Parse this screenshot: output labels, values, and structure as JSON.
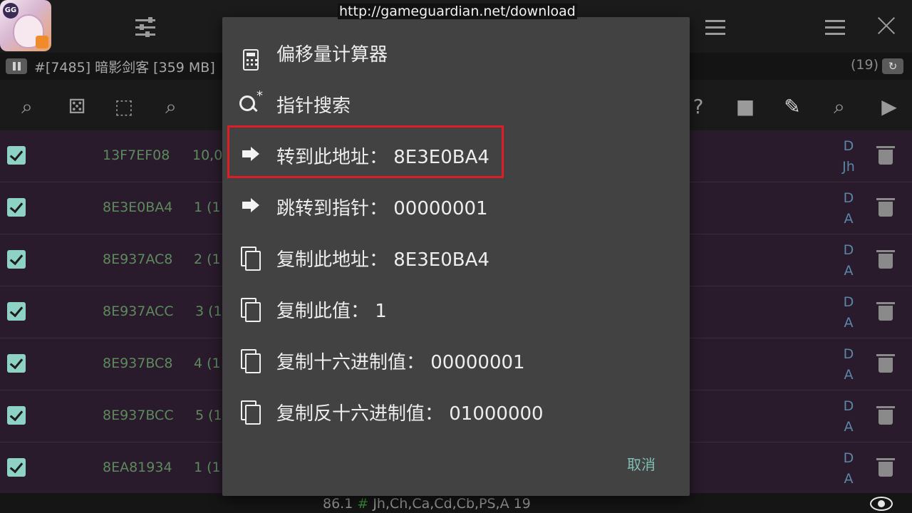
{
  "url_overlay": "http://gameguardian.net/download",
  "status": {
    "process": "#[7485] 暗影剑客 [359 MB]",
    "count": "(19)"
  },
  "rows": [
    {
      "address": "13F7EF08",
      "value": "10,0",
      "type_top": "D",
      "type_bottom": "Jh"
    },
    {
      "address": "8E3E0BA4",
      "value": "1 (1",
      "type_top": "D",
      "type_bottom": "A"
    },
    {
      "address": "8E937AC8",
      "value": "2 (1",
      "type_top": "D",
      "type_bottom": "A"
    },
    {
      "address": "8E937ACC",
      "value": "3 (1",
      "type_top": "D",
      "type_bottom": "A"
    },
    {
      "address": "8E937BC8",
      "value": "4 (1",
      "type_top": "D",
      "type_bottom": "A"
    },
    {
      "address": "8E937BCC",
      "value": "5 (1",
      "type_top": "D",
      "type_bottom": "A"
    },
    {
      "address": "8EA81934",
      "value": "1 (1",
      "type_top": "D",
      "type_bottom": "A"
    }
  ],
  "dialog": {
    "items": [
      {
        "label": "偏移量计算器",
        "icon": "calculator-icon"
      },
      {
        "label": "指针搜索",
        "icon": "pointer-search-icon"
      },
      {
        "label": "转到此地址： 8E3E0BA4",
        "icon": "arrow-right-icon"
      },
      {
        "label": "跳转到指针： 00000001",
        "icon": "arrow-right-icon"
      },
      {
        "label": "复制此地址： 8E3E0BA4",
        "icon": "copy-icon"
      },
      {
        "label": "复制此值： 1",
        "icon": "copy-icon"
      },
      {
        "label": "复制十六进制值： 00000001",
        "icon": "copy-icon"
      },
      {
        "label": "复制反十六进制值： 01000000",
        "icon": "copy-icon"
      }
    ],
    "cancel_label": "取消"
  },
  "bottom": {
    "version": "86.1",
    "hash": "#",
    "regions": "Jh,Ch,Ca,Cd,Cb,PS,A",
    "total": "19"
  },
  "colors": {
    "dialog_bg": "#424242",
    "highlight": "#e01c24",
    "accent": "#7fbfb4",
    "row_bg": "#2a1b2c"
  }
}
